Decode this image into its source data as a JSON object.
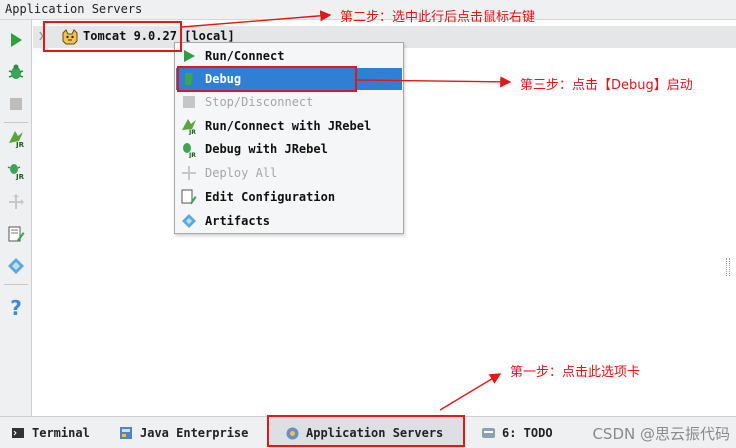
{
  "window": {
    "title": "Application Servers"
  },
  "server": {
    "name": "Tomcat 9.0.27",
    "tag": "[local]"
  },
  "context_menu": {
    "items": [
      {
        "label": "Run/Connect",
        "icon": "run-icon",
        "state": "enabled"
      },
      {
        "label": "Debug",
        "icon": "debug-icon",
        "state": "selected"
      },
      {
        "label": "Stop/Disconnect",
        "icon": "stop-icon",
        "state": "disabled"
      },
      {
        "label": "Run/Connect with JRebel",
        "icon": "jrebel-run-icon",
        "state": "enabled"
      },
      {
        "label": "Debug with JRebel",
        "icon": "jrebel-debug-icon",
        "state": "enabled"
      },
      {
        "label": "Deploy All",
        "icon": "deploy-icon",
        "state": "disabled"
      },
      {
        "label": "Edit Configuration",
        "icon": "edit-configuration-icon",
        "state": "enabled"
      },
      {
        "label": "Artifacts",
        "icon": "artifacts-icon",
        "state": "enabled"
      }
    ]
  },
  "toolbar": {
    "buttons": [
      "run-icon",
      "debug-icon",
      "stop-icon",
      "jrebel-run-icon",
      "jrebel-debug-icon",
      "deploy-icon",
      "edit-configuration-icon",
      "artifacts-icon",
      "help-icon"
    ],
    "help_glyph": "?"
  },
  "statusbar": {
    "tabs": [
      {
        "label": "Terminal",
        "icon": "terminal-icon"
      },
      {
        "label": "Java Enterprise",
        "icon": "java-enterprise-icon"
      },
      {
        "label": "Application Servers",
        "icon": "application-servers-icon",
        "active": true
      },
      {
        "label": "6: TODO",
        "icon": "todo-icon"
      }
    ],
    "watermark": "CSDN @思云振代码"
  },
  "annotations": {
    "step1": "第一步：点击此选项卡",
    "step2": "第二步：选中此行后点击鼠标右键",
    "step3": "第三步：点击【Debug】启动"
  },
  "colors": {
    "annotation_red": "#e01818",
    "menu_selected": "#2f7fd4",
    "run_green": "#2ea043",
    "help_blue": "#3b8ad6"
  }
}
